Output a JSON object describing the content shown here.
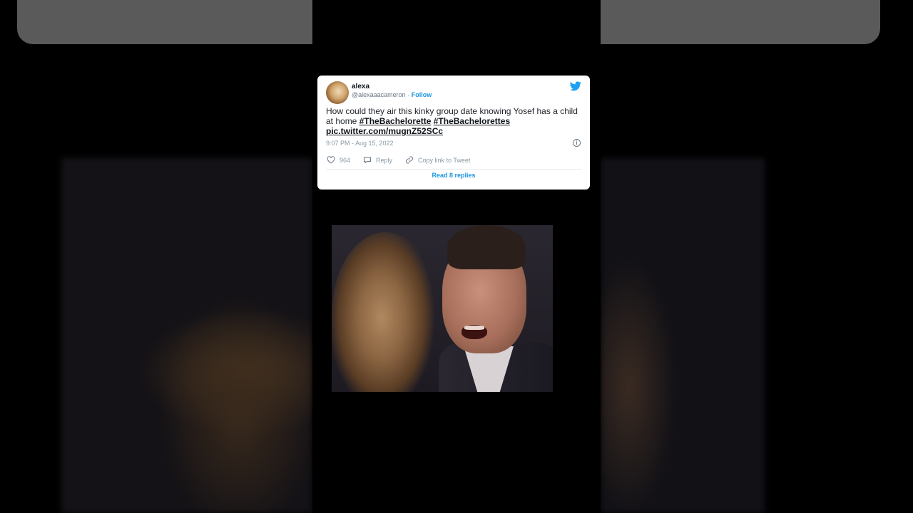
{
  "tweet": {
    "name": "alexa",
    "handle": "@alexaaacameron",
    "separator": "·",
    "follow_label": "Follow",
    "text_plain": "How could they air this kinky group date knowing Yosef has a child at home",
    "hashtag_1": "#TheBachelorette",
    "hashtag_2": "#TheBachelorettes",
    "link": "pic.twitter.com/mugnZ52SCc",
    "timestamp": "9:07 PM - Aug 15, 2022",
    "likes": "964",
    "reply_label": "Reply",
    "copy_label": "Copy link to Tweet",
    "read_replies": "Read 8 replies"
  },
  "colors": {
    "accent": "#1b95e0",
    "background": "#000000"
  },
  "icons": {
    "brand": "twitter-bird-icon",
    "like": "heart-icon",
    "reply": "reply-icon",
    "copy": "link-icon",
    "info": "info-icon"
  }
}
